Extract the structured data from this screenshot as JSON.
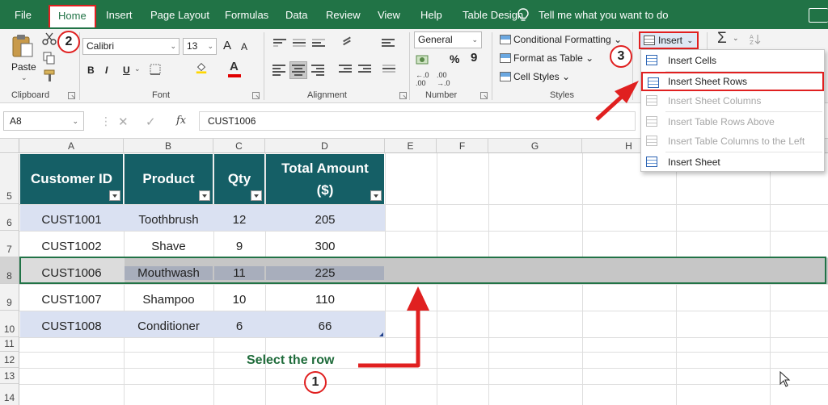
{
  "ribbon_tabs": [
    {
      "label": "File"
    },
    {
      "label": "Home"
    },
    {
      "label": "Insert"
    },
    {
      "label": "Page Layout"
    },
    {
      "label": "Formulas"
    },
    {
      "label": "Data"
    },
    {
      "label": "Review"
    },
    {
      "label": "View"
    },
    {
      "label": "Help"
    },
    {
      "label": "Table Design"
    }
  ],
  "tell_me": "Tell me what you want to do",
  "clipboard": {
    "paste_label": "Paste",
    "group_label": "Clipboard"
  },
  "font": {
    "name": "Calibri",
    "size": "13",
    "bold": "B",
    "italic": "I",
    "underline": "U",
    "grow": "A",
    "shrink": "A",
    "group_label": "Font"
  },
  "alignment": {
    "group_label": "Alignment"
  },
  "number": {
    "format": "General",
    "currency": "$",
    "percent": "%",
    "comma": "9",
    "inc_decimal": "←.0 .00",
    "dec_decimal": ".00 →.0",
    "group_label": "Number"
  },
  "styles": {
    "conditional": "Conditional Formatting",
    "format_table": "Format as Table",
    "cell_styles": "Cell Styles",
    "group_label": "Styles"
  },
  "cells": {
    "insert_label": "Insert"
  },
  "editing": {
    "sum_symbol": "Σ"
  },
  "insert_menu": [
    {
      "label": "Insert Cells",
      "enabled": true
    },
    {
      "label": "Insert Sheet Rows",
      "enabled": true
    },
    {
      "label": "Insert Sheet Columns",
      "enabled": false
    },
    {
      "label": "Insert Table Rows Above",
      "enabled": false
    },
    {
      "label": "Insert Table Columns to the Left",
      "enabled": false
    },
    {
      "label": "Insert Sheet",
      "enabled": true
    }
  ],
  "formula_bar": {
    "name_box": "A8",
    "fx": "fx",
    "value": "CUST1006"
  },
  "columns": [
    "A",
    "B",
    "C",
    "D",
    "E",
    "F",
    "G",
    "H"
  ],
  "rows": [
    "5",
    "6",
    "7",
    "8",
    "9",
    "10",
    "11",
    "12",
    "13",
    "14"
  ],
  "table": {
    "headers": [
      "Customer ID",
      "Product",
      "Qty",
      "Total Amount ($)"
    ],
    "header_line1": "Total Amount",
    "header_line2": "($)",
    "rows": [
      [
        "CUST1001",
        "Toothbrush",
        "12",
        "205"
      ],
      [
        "CUST1002",
        "Shave",
        "9",
        "300"
      ],
      [
        "CUST1006",
        "Mouthwash",
        "11",
        "225"
      ],
      [
        "CUST1007",
        "Shampoo",
        "10",
        "110"
      ],
      [
        "CUST1008",
        "Conditioner",
        "6",
        "66"
      ]
    ]
  },
  "annotations": {
    "select_text": "Select the row",
    "step1": "1",
    "step2": "2",
    "step3": "3"
  },
  "colors": {
    "excel_green": "#217346",
    "header_teal": "#155f66",
    "band_blue": "#dae1f2",
    "annotation_red": "#e02020",
    "selected_gray": "#c6c6c6"
  }
}
